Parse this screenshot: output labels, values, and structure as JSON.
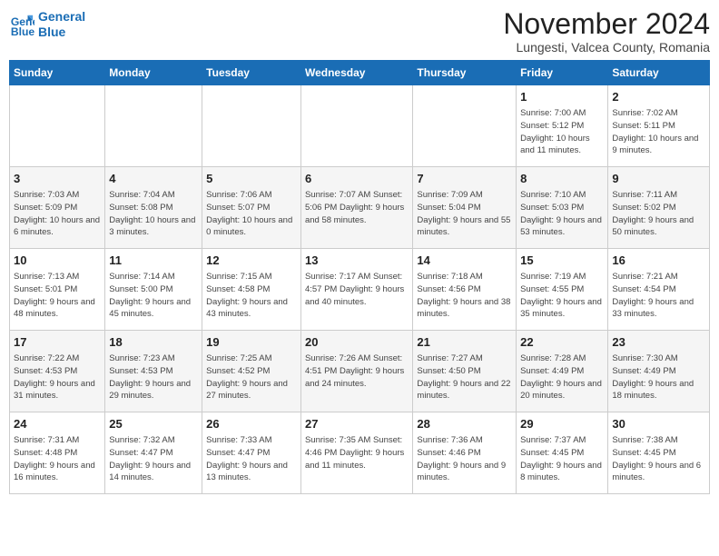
{
  "logo": {
    "line1": "General",
    "line2": "Blue"
  },
  "title": "November 2024",
  "subtitle": "Lungesti, Valcea County, Romania",
  "weekdays": [
    "Sunday",
    "Monday",
    "Tuesday",
    "Wednesday",
    "Thursday",
    "Friday",
    "Saturday"
  ],
  "weeks": [
    [
      {
        "day": "",
        "info": ""
      },
      {
        "day": "",
        "info": ""
      },
      {
        "day": "",
        "info": ""
      },
      {
        "day": "",
        "info": ""
      },
      {
        "day": "",
        "info": ""
      },
      {
        "day": "1",
        "info": "Sunrise: 7:00 AM\nSunset: 5:12 PM\nDaylight: 10 hours\nand 11 minutes."
      },
      {
        "day": "2",
        "info": "Sunrise: 7:02 AM\nSunset: 5:11 PM\nDaylight: 10 hours\nand 9 minutes."
      }
    ],
    [
      {
        "day": "3",
        "info": "Sunrise: 7:03 AM\nSunset: 5:09 PM\nDaylight: 10 hours\nand 6 minutes."
      },
      {
        "day": "4",
        "info": "Sunrise: 7:04 AM\nSunset: 5:08 PM\nDaylight: 10 hours\nand 3 minutes."
      },
      {
        "day": "5",
        "info": "Sunrise: 7:06 AM\nSunset: 5:07 PM\nDaylight: 10 hours\nand 0 minutes."
      },
      {
        "day": "6",
        "info": "Sunrise: 7:07 AM\nSunset: 5:06 PM\nDaylight: 9 hours\nand 58 minutes."
      },
      {
        "day": "7",
        "info": "Sunrise: 7:09 AM\nSunset: 5:04 PM\nDaylight: 9 hours\nand 55 minutes."
      },
      {
        "day": "8",
        "info": "Sunrise: 7:10 AM\nSunset: 5:03 PM\nDaylight: 9 hours\nand 53 minutes."
      },
      {
        "day": "9",
        "info": "Sunrise: 7:11 AM\nSunset: 5:02 PM\nDaylight: 9 hours\nand 50 minutes."
      }
    ],
    [
      {
        "day": "10",
        "info": "Sunrise: 7:13 AM\nSunset: 5:01 PM\nDaylight: 9 hours\nand 48 minutes."
      },
      {
        "day": "11",
        "info": "Sunrise: 7:14 AM\nSunset: 5:00 PM\nDaylight: 9 hours\nand 45 minutes."
      },
      {
        "day": "12",
        "info": "Sunrise: 7:15 AM\nSunset: 4:58 PM\nDaylight: 9 hours\nand 43 minutes."
      },
      {
        "day": "13",
        "info": "Sunrise: 7:17 AM\nSunset: 4:57 PM\nDaylight: 9 hours\nand 40 minutes."
      },
      {
        "day": "14",
        "info": "Sunrise: 7:18 AM\nSunset: 4:56 PM\nDaylight: 9 hours\nand 38 minutes."
      },
      {
        "day": "15",
        "info": "Sunrise: 7:19 AM\nSunset: 4:55 PM\nDaylight: 9 hours\nand 35 minutes."
      },
      {
        "day": "16",
        "info": "Sunrise: 7:21 AM\nSunset: 4:54 PM\nDaylight: 9 hours\nand 33 minutes."
      }
    ],
    [
      {
        "day": "17",
        "info": "Sunrise: 7:22 AM\nSunset: 4:53 PM\nDaylight: 9 hours\nand 31 minutes."
      },
      {
        "day": "18",
        "info": "Sunrise: 7:23 AM\nSunset: 4:53 PM\nDaylight: 9 hours\nand 29 minutes."
      },
      {
        "day": "19",
        "info": "Sunrise: 7:25 AM\nSunset: 4:52 PM\nDaylight: 9 hours\nand 27 minutes."
      },
      {
        "day": "20",
        "info": "Sunrise: 7:26 AM\nSunset: 4:51 PM\nDaylight: 9 hours\nand 24 minutes."
      },
      {
        "day": "21",
        "info": "Sunrise: 7:27 AM\nSunset: 4:50 PM\nDaylight: 9 hours\nand 22 minutes."
      },
      {
        "day": "22",
        "info": "Sunrise: 7:28 AM\nSunset: 4:49 PM\nDaylight: 9 hours\nand 20 minutes."
      },
      {
        "day": "23",
        "info": "Sunrise: 7:30 AM\nSunset: 4:49 PM\nDaylight: 9 hours\nand 18 minutes."
      }
    ],
    [
      {
        "day": "24",
        "info": "Sunrise: 7:31 AM\nSunset: 4:48 PM\nDaylight: 9 hours\nand 16 minutes."
      },
      {
        "day": "25",
        "info": "Sunrise: 7:32 AM\nSunset: 4:47 PM\nDaylight: 9 hours\nand 14 minutes."
      },
      {
        "day": "26",
        "info": "Sunrise: 7:33 AM\nSunset: 4:47 PM\nDaylight: 9 hours\nand 13 minutes."
      },
      {
        "day": "27",
        "info": "Sunrise: 7:35 AM\nSunset: 4:46 PM\nDaylight: 9 hours\nand 11 minutes."
      },
      {
        "day": "28",
        "info": "Sunrise: 7:36 AM\nSunset: 4:46 PM\nDaylight: 9 hours\nand 9 minutes."
      },
      {
        "day": "29",
        "info": "Sunrise: 7:37 AM\nSunset: 4:45 PM\nDaylight: 9 hours\nand 8 minutes."
      },
      {
        "day": "30",
        "info": "Sunrise: 7:38 AM\nSunset: 4:45 PM\nDaylight: 9 hours\nand 6 minutes."
      }
    ]
  ]
}
